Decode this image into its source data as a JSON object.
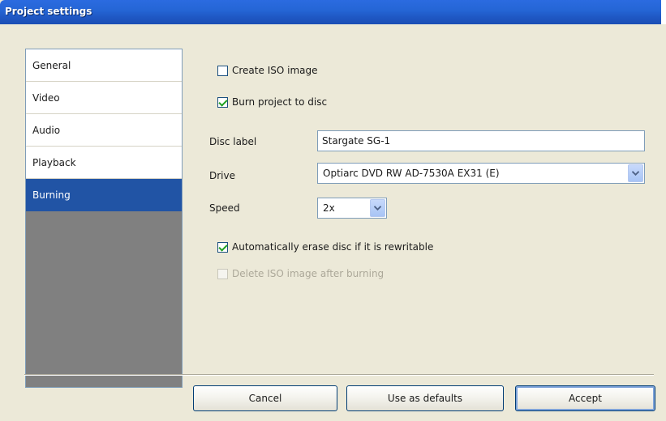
{
  "window": {
    "title": "Project settings"
  },
  "nav": {
    "items": [
      {
        "label": "General",
        "selected": false
      },
      {
        "label": "Video",
        "selected": false
      },
      {
        "label": "Audio",
        "selected": false
      },
      {
        "label": "Playback",
        "selected": false
      },
      {
        "label": "Burning",
        "selected": true
      }
    ]
  },
  "burning": {
    "create_iso": {
      "label": "Create ISO image",
      "checked": false
    },
    "burn_to_disc": {
      "label": "Burn project to disc",
      "checked": true
    },
    "disc_label": {
      "label": "Disc label",
      "value": "Stargate SG-1"
    },
    "drive": {
      "label": "Drive",
      "value": "Optiarc DVD RW AD-7530A EX31 (E)"
    },
    "speed": {
      "label": "Speed",
      "value": "2x"
    },
    "auto_erase": {
      "label": "Automatically erase disc if it is rewritable",
      "checked": true
    },
    "delete_iso": {
      "label": "Delete ISO image after burning",
      "checked": false,
      "enabled": false
    }
  },
  "buttons": {
    "cancel": "Cancel",
    "use_defaults": "Use as defaults",
    "accept": "Accept"
  },
  "colors": {
    "titlebar": "#2566d6",
    "selected_nav": "#2154a5",
    "checkmark": "#21a121"
  }
}
